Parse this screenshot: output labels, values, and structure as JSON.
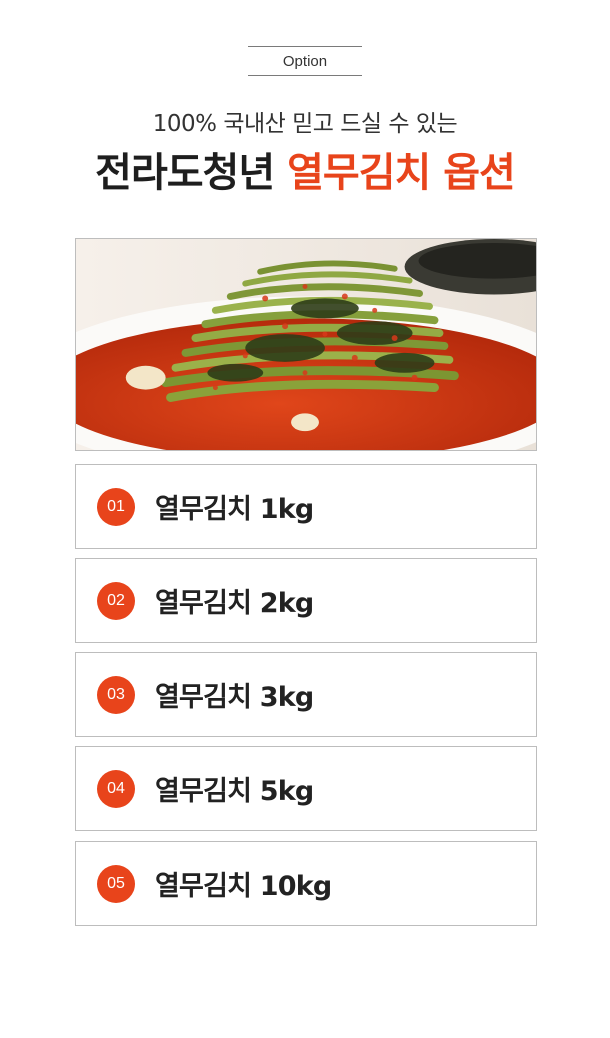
{
  "header": {
    "option_label": "Option",
    "subtitle": "100% 국내산 믿고 드실 수 있는",
    "headline_brand": "전라도청년",
    "headline_accent": "열무김치 옵션"
  },
  "colors": {
    "accent": "#e8441b",
    "text_dark": "#1e1e1e",
    "border": "#bdbdbd"
  },
  "options": [
    {
      "number": "01",
      "label": "열무김치 1kg"
    },
    {
      "number": "02",
      "label": "열무김치 2kg"
    },
    {
      "number": "03",
      "label": "열무김치 3kg"
    },
    {
      "number": "04",
      "label": "열무김치 5kg"
    },
    {
      "number": "05",
      "label": "열무김치 10kg"
    }
  ]
}
